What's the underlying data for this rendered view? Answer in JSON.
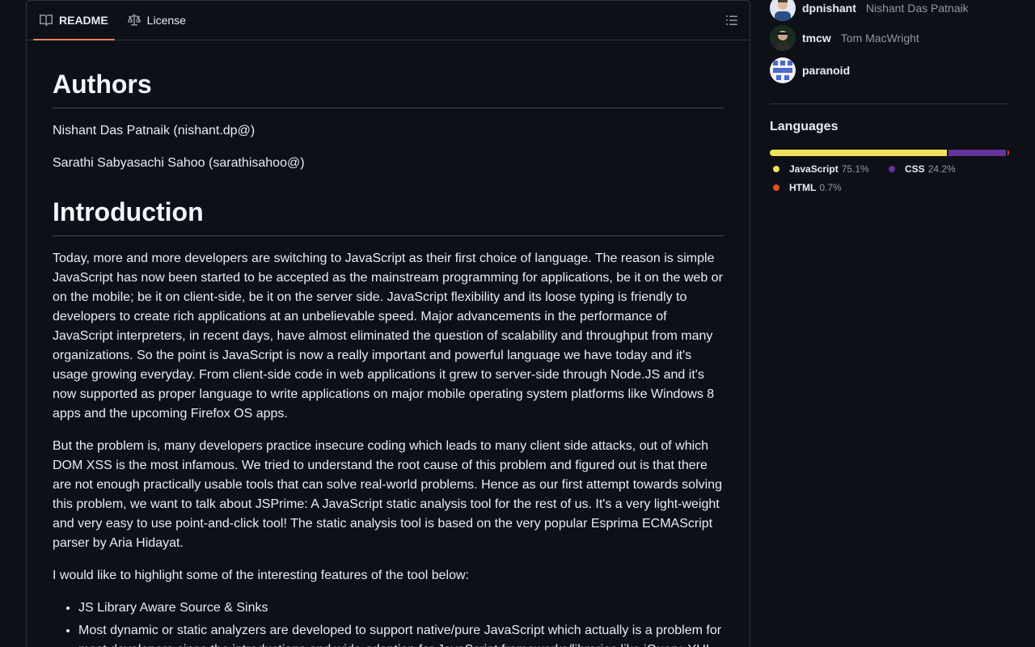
{
  "tabs": {
    "readme": "README",
    "license": "License"
  },
  "article": {
    "authors_heading": "Authors",
    "author1": "Nishant Das Patnaik (nishant.dp@)",
    "author2": "Sarathi Sabyasachi Sahoo (sarathisahoo@)",
    "intro_heading": "Introduction",
    "intro_p1": "Today, more and more developers are switching to JavaScript as their first choice of language. The reason is simple JavaScript has now been started to be accepted as the mainstream programming for applications, be it on the web or on the mobile; be it on client-side, be it on the server side. JavaScript flexibility and its loose typing is friendly to developers to create rich applications at an unbelievable speed. Major advancements in the performance of JavaScript interpreters, in recent days, have almost eliminated the question of scalability and throughput from many organizations. So the point is JavaScript is now a really important and powerful language we have today and it's usage growing everyday. From client-side code in web applications it grew to server-side through Node.JS and it's now supported as proper language to write applications on major mobile operating system platforms like Windows 8 apps and the upcoming Firefox OS apps.",
    "intro_p2": "But the problem is, many developers practice insecure coding which leads to many client side attacks, out of which DOM XSS is the most infamous. We tried to understand the root cause of this problem and figured out is that there are not enough practically usable tools that can solve real-world problems. Hence as our first attempt towards solving this problem, we want to talk about JSPrime: A JavaScript static analysis tool for the rest of us. It's a very light-weight and very easy to use point-and-click tool! The static analysis tool is based on the very popular Esprima ECMAScript parser by Aria Hidayat.",
    "intro_p3": "I would like to highlight some of the interesting features of the tool below:",
    "features": [
      "JS Library Aware Source & Sinks",
      "Most dynamic or static analyzers are developed to support native/pure JavaScript which actually is a problem for most developers since the introductions and wide-adoption for JavaScript frameworks/libraries like jQuery, YUI"
    ]
  },
  "contributors": [
    {
      "login": "dpnishant",
      "name": "Nishant Das Patnaik"
    },
    {
      "login": "tmcw",
      "name": "Tom MacWright"
    },
    {
      "login": "paranoid",
      "name": ""
    }
  ],
  "languages": {
    "title": "Languages",
    "items": [
      {
        "name": "JavaScript",
        "percent": "75.1%",
        "value": 75.1,
        "color": "#f1e05a"
      },
      {
        "name": "CSS",
        "percent": "24.2%",
        "value": 24.2,
        "color": "#663399"
      },
      {
        "name": "HTML",
        "percent": "0.7%",
        "value": 0.7,
        "color": "#e34c26"
      }
    ]
  }
}
